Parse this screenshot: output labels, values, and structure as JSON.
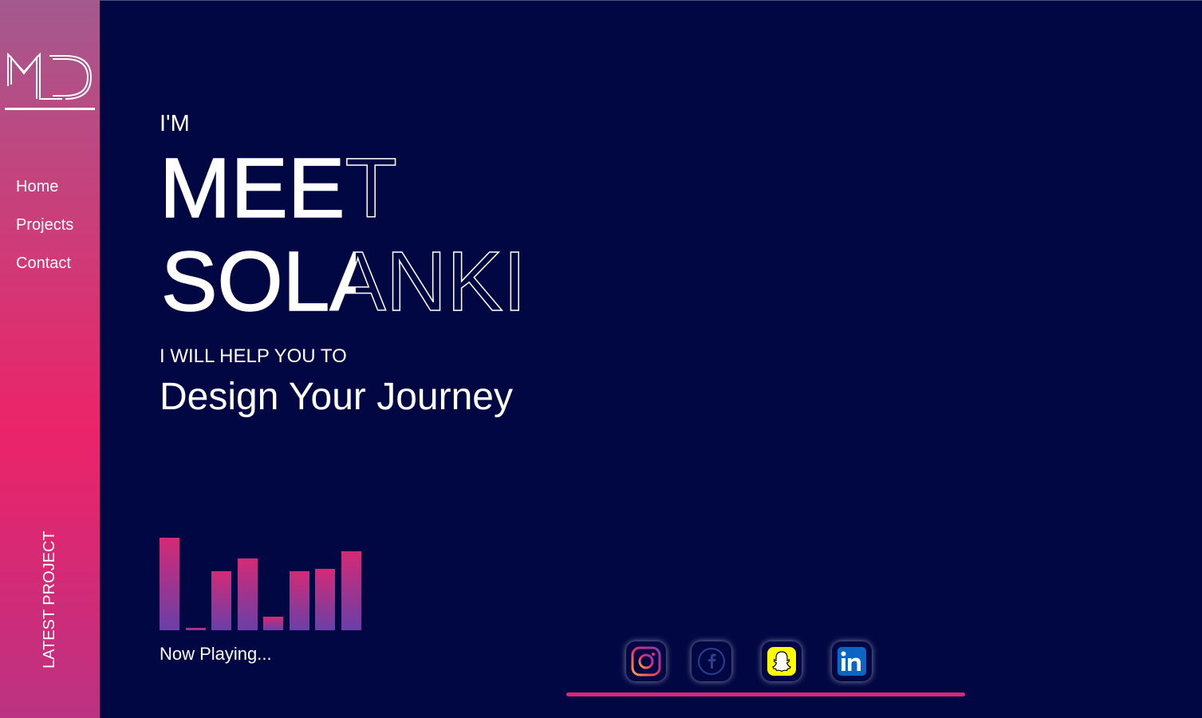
{
  "sidebar": {
    "logo_text": "MD",
    "nav": [
      "Home",
      "Projects",
      "Contact"
    ],
    "latest_project": "LATEST PROJECT"
  },
  "hero": {
    "intro": "I'M",
    "first_name": "MEET",
    "last_name": "SOLANKI",
    "subtitle": "I WILL HELP YOU TO",
    "tagline": "Design Your Journey"
  },
  "player": {
    "status": "Now Playing...",
    "equalizer_levels": [
      0.89,
      0.02,
      0.57,
      0.69,
      0.13,
      0.57,
      0.59,
      0.76
    ]
  },
  "social": [
    {
      "name": "instagram",
      "icon": "instagram-icon"
    },
    {
      "name": "facebook",
      "icon": "facebook-icon"
    },
    {
      "name": "snapchat",
      "icon": "snapchat-icon"
    },
    {
      "name": "linkedin",
      "icon": "linkedin-icon"
    }
  ],
  "colors": {
    "background": "#000742",
    "accent": "#d42a76",
    "sidebar_gradient": [
      "#a35a8f",
      "#eb2468",
      "#bb3382"
    ]
  }
}
